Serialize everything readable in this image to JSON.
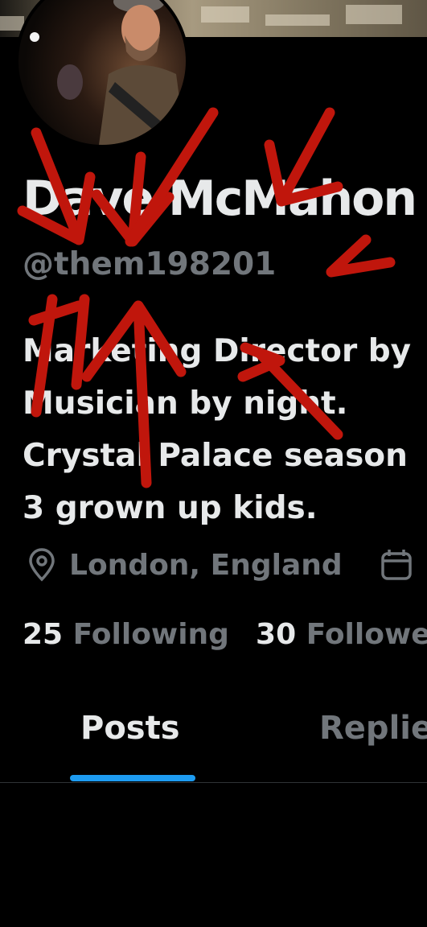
{
  "profile": {
    "name": "Dave McMahon",
    "handle": "@them198201",
    "bio_lines": [
      "Marketing Director by",
      "Musician by night.",
      "Crystal Palace season",
      "3 grown up kids."
    ],
    "location": "London, England",
    "location_icon": "map-pin-icon",
    "joined_icon": "calendar-icon",
    "following_count": "25",
    "following_label": "Following",
    "followers_count": "30",
    "followers_label": "Followe"
  },
  "tabs": [
    {
      "label": "Posts",
      "active": true
    },
    {
      "label": "Replie",
      "active": false
    }
  ],
  "colors": {
    "background": "#000000",
    "text_primary": "#e7e9ea",
    "text_secondary": "#71767b",
    "accent": "#1d9bf0",
    "annotation_red": "#c0160c"
  }
}
